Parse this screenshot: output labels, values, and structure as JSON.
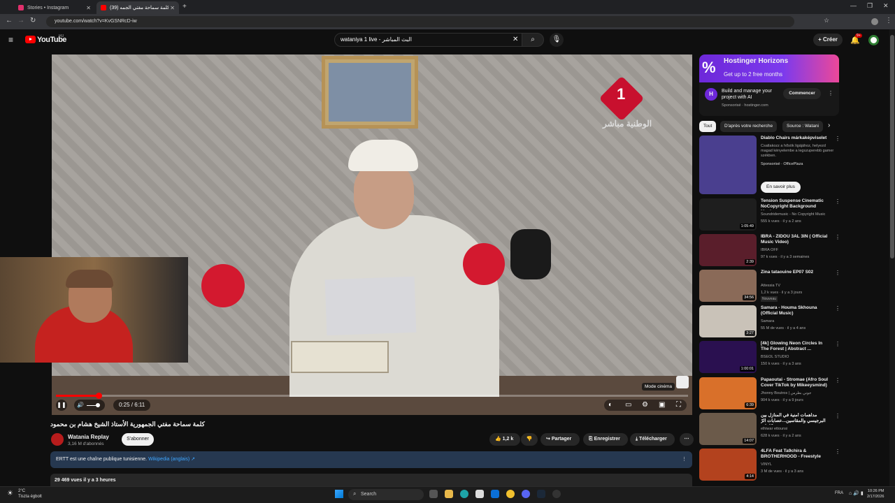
{
  "browser": {
    "tabs": [
      {
        "label": "Stories • Instagram",
        "color": "#e1306c"
      },
      {
        "label": "كلمة سماحة مفتي الجمه (39)",
        "color": "#ff0000"
      }
    ],
    "url": "youtube.com/watch?v=KvGSNRcD-iw",
    "new_tab": "+",
    "close": "✕",
    "win_min": "—",
    "win_max": "❐",
    "win_close": "✕"
  },
  "header": {
    "logo": "YouTube",
    "region": "HU",
    "search_value": "wataniya 1 live - البث المباشر",
    "create_label": "+ Créer",
    "notif_count": "9+"
  },
  "player": {
    "overlay_logo": "1",
    "overlay_channel": "الوطنية مباشر",
    "time": "0:25 / 6:11",
    "progress": 0.067,
    "tooltip": "Mode cinéma"
  },
  "video": {
    "title": "كلمة سماحة مفتي الجمهورية الأستاذ الشيخ هشام بن محمود",
    "channel": "Watania Replay",
    "subs": "3,16 M d'abonnés",
    "subscribe": "S'abonner",
    "likes": "1,2 k",
    "share": "Partager",
    "save": "Enregistrer",
    "download": "Télécharger",
    "info_text": "ERTT est une chaîne publique tunisienne.",
    "info_link": "Wikipedia (anglais) ↗",
    "views": "29 469 vues  il y a 3 heures"
  },
  "ad": {
    "headline": "Hostinger Horizons",
    "sub": "Get up to 2 free months",
    "body": "Build and manage your project with AI",
    "sponsored": "Sponsorisé · hostinger.com",
    "cta": "Commencer"
  },
  "chips": [
    "Tout",
    "D'après votre recherche",
    "Source : Watani"
  ],
  "recommendations": [
    {
      "title": "Diablo Chairs márkaképviselet",
      "channel": "Csatlakozz a hősök ligájához, helyezd magad kényelembe a legszuperebb gamer székben.",
      "meta": "Sponsorisé · OfficePlaza",
      "duration": "",
      "color": "#4a3f8f",
      "cta": "En savoir plus"
    },
    {
      "title": "Tension Suspense Cinematic NoCopyright Background Musi...",
      "channel": "Soundridemusic - No Copyright Music",
      "meta": "555 k vues · il y a 2 ans",
      "duration": "1:05:49",
      "color": "#1e1e1e"
    },
    {
      "title": "IBRA - ZIDOU 3AL 3IN ( Official Music Video)",
      "channel": "IBRA OFF",
      "meta": "97 k vues · il y a 3 semaines",
      "duration": "2:39",
      "color": "#5a1e2b"
    },
    {
      "title": "Zina tataouine   EP07 S02",
      "channel": "Attessia TV",
      "meta": "1,2 k vues · il y a 3 jours",
      "duration": "34:56",
      "color": "#8a6a58",
      "badge": "Nouveau"
    },
    {
      "title": "Samara - Houma Skhouna (Official Music)",
      "channel": "Samara",
      "meta": "55 M de vues · il y a 4 ans",
      "duration": "3:27",
      "color": "#c9c2b8"
    },
    {
      "title": "[4k] Glowing Neon Circles In The Forest | Abstract ...",
      "channel": "BSEOL STUDIO",
      "meta": "150 k vues · il y a 3 ans",
      "duration": "1:00:01",
      "color": "#2a1050"
    },
    {
      "title": "Papaoutai - Stromae (Afro Soul Cover TikTok by Mikeeysmind)",
      "channel": "Jhonny Boutros | جوني بطرس",
      "meta": "904 k vues · il y a 9 jours",
      "duration": "6:39",
      "color": "#d9702a"
    },
    {
      "title": "مداهمات أمنية في المنازل بين البرجيسي والمقاسين...عصابات الرّ كاعات ...",
      "channel": "elhiwar ettounsi",
      "meta": "628 k vues · il y a 2 ans",
      "duration": "14:07",
      "color": "#6b5a4a"
    },
    {
      "title": "4LFA Feat Ta9chira & BROTHERHOOD - Freestyle",
      "channel": "VINYL",
      "meta": "3 M de vues · il y a 3 ans",
      "duration": "4:14",
      "color": "#b3421e"
    }
  ],
  "taskbar": {
    "temp": "2°C",
    "weather": "Tiszta égbolt",
    "search": "Search",
    "lang": "FRA",
    "time": "10:26 PM",
    "date": "2/17/2026"
  }
}
